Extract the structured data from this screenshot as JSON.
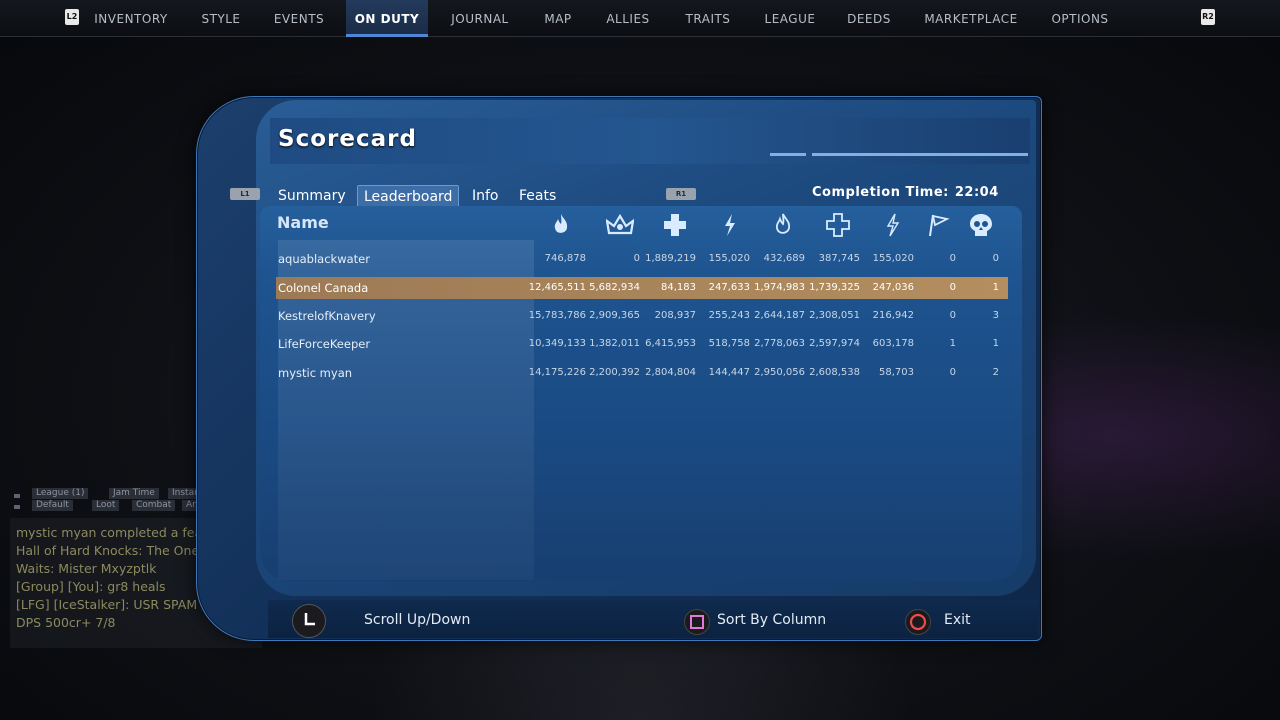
{
  "nav": {
    "left_shoulder": "L2",
    "right_shoulder": "R2",
    "items": [
      {
        "label": "INVENTORY"
      },
      {
        "label": "STYLE"
      },
      {
        "label": "EVENTS"
      },
      {
        "label": "ON DUTY",
        "active": true
      },
      {
        "label": "JOURNAL"
      },
      {
        "label": "MAP"
      },
      {
        "label": "ALLIES"
      },
      {
        "label": "TRAITS"
      },
      {
        "label": "LEAGUE"
      },
      {
        "label": "DEEDS"
      },
      {
        "label": "MARKETPLACE"
      },
      {
        "label": "OPTIONS"
      }
    ]
  },
  "scorecard": {
    "title": "Scorecard",
    "tab_hint_left": "L1",
    "tab_hint_right": "R1",
    "tabs": [
      {
        "label": "Summary"
      },
      {
        "label": "Leaderboard",
        "active": true
      },
      {
        "label": "Info"
      },
      {
        "label": "Feats"
      }
    ],
    "completion_label": "Completion Time:",
    "completion_value": "22:04",
    "name_header": "Name",
    "column_icons": [
      "flame-icon",
      "crown-burst-icon",
      "heal-cross-icon",
      "lightning-icon",
      "flame-outline-icon",
      "cross-outline-icon",
      "lightning-outline-icon",
      "flag-icon",
      "skull-icon"
    ],
    "rows": [
      {
        "name": "aquablackwater",
        "values": [
          "746,878",
          "0",
          "1,889,219",
          "155,020",
          "432,689",
          "387,745",
          "155,020",
          "0",
          "0"
        ]
      },
      {
        "name": "Colonel Canada",
        "selected": true,
        "values": [
          "12,465,511",
          "5,682,934",
          "84,183",
          "247,633",
          "1,974,983",
          "1,739,325",
          "247,036",
          "0",
          "1"
        ]
      },
      {
        "name": "KestrelofKnavery",
        "values": [
          "15,783,786",
          "2,909,365",
          "208,937",
          "255,243",
          "2,644,187",
          "2,308,051",
          "216,942",
          "0",
          "3"
        ]
      },
      {
        "name": "LifeForceKeeper",
        "values": [
          "10,349,133",
          "1,382,011",
          "6,415,953",
          "518,758",
          "2,778,063",
          "2,597,974",
          "603,178",
          "1",
          "1"
        ]
      },
      {
        "name": "mystic myan",
        "values": [
          "14,175,226",
          "2,200,392",
          "2,804,804",
          "144,447",
          "2,950,056",
          "2,608,538",
          "58,703",
          "0",
          "2"
        ]
      }
    ]
  },
  "controls": {
    "scroll_label": "Scroll Up/Down",
    "sort_label": "Sort By Column",
    "exit_label": "Exit"
  },
  "chat": {
    "tabs_row1": [
      "League (1)",
      "Jam Time",
      "Instance"
    ],
    "tabs_row2": [
      "Default",
      "Loot",
      "Combat",
      "Area"
    ],
    "lines": [
      "mystic myan completed a feat: Leag",
      "Hall of Hard Knocks: The One Who",
      "Waits: Mister Mxyzptlk",
      "[Group] [You]: gr8 heals",
      "[LFG] [IceStalker]: USR SPAM NEED",
      "DPS 500cr+ 7/8"
    ]
  },
  "colors": {
    "panel_blue": "#1d4a7f",
    "selected_row": "#b48e5f",
    "active_nav": "#243a5c",
    "chat_text": "#8c8a5f"
  }
}
